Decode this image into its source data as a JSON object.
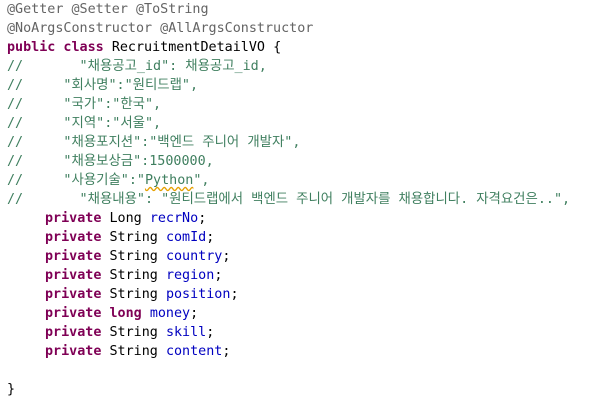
{
  "annotations": {
    "line1": "@Getter @Setter @ToString",
    "line2": "@NoArgsConstructor @AllArgsConstructor"
  },
  "class_decl": {
    "modifiers": "public class",
    "name": "RecruitmentDetailVO",
    "brace": "{"
  },
  "comments": [
    {
      "prefix": "//",
      "text": "       \"채용공고_id\": 채용공고_id,"
    },
    {
      "prefix": "//",
      "text": "     \"회사명\":\"원티드랩\","
    },
    {
      "prefix": "//",
      "text": "     \"국가\":\"한국\","
    },
    {
      "prefix": "//",
      "text": "     \"지역\":\"서울\","
    },
    {
      "prefix": "//",
      "text": "     \"채용포지션\":\"백엔드 주니어 개발자\","
    },
    {
      "prefix": "//",
      "text": "     \"채용보상금\":1500000,"
    },
    {
      "prefix": "//",
      "text_before": "     \"사용기술\":\"",
      "text_squiggle": "Python",
      "text_after": "\","
    },
    {
      "prefix": "//",
      "text": "       \"채용내용\": \"원티드랩에서 백엔드 주니어 개발자를 채용합니다. 자격요건은..\","
    }
  ],
  "fields": [
    {
      "modifier": "private",
      "type": "Long",
      "name": "recrNo",
      "end": ";"
    },
    {
      "modifier": "private",
      "type": "String",
      "name": "comId",
      "end": ";"
    },
    {
      "modifier": "private",
      "type": "String",
      "name": "country",
      "end": ";"
    },
    {
      "modifier": "private",
      "type": "String",
      "name": "region",
      "end": ";"
    },
    {
      "modifier": "private",
      "type": "String",
      "name": "position",
      "end": ";"
    },
    {
      "modifier": "private",
      "type_keyword": "long",
      "name": "money",
      "end": ";"
    },
    {
      "modifier": "private",
      "type": "String",
      "name": "skill",
      "end": ";"
    },
    {
      "modifier": "private",
      "type": "String",
      "name": "content",
      "end": ";"
    }
  ],
  "closing_brace": "}"
}
